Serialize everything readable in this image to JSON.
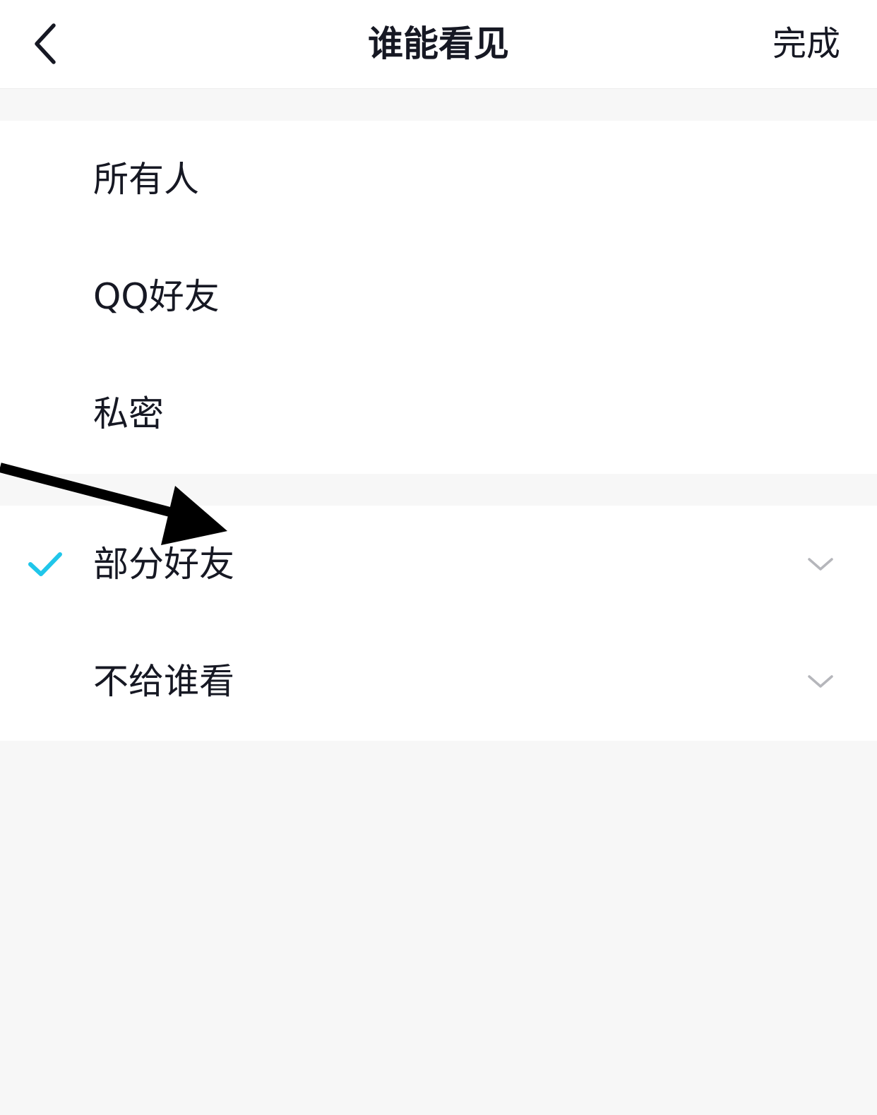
{
  "header": {
    "back_icon": "chevron-left-icon",
    "title": "谁能看见",
    "done_label": "完成"
  },
  "visibility_options": [
    {
      "label": "所有人",
      "selected": false
    },
    {
      "label": "QQ好友",
      "selected": false
    },
    {
      "label": "私密",
      "selected": false
    }
  ],
  "friend_options": [
    {
      "label": "部分好友",
      "selected": true,
      "icon": "chevron-down-icon"
    },
    {
      "label": "不给谁看",
      "selected": false,
      "icon": "chevron-down-icon"
    }
  ],
  "colors": {
    "accent_check": "#20c6ea",
    "text_primary": "#161823",
    "chevron": "#b5b6bb",
    "background": "#f7f7f7",
    "annotation_arrow": "#000000"
  }
}
